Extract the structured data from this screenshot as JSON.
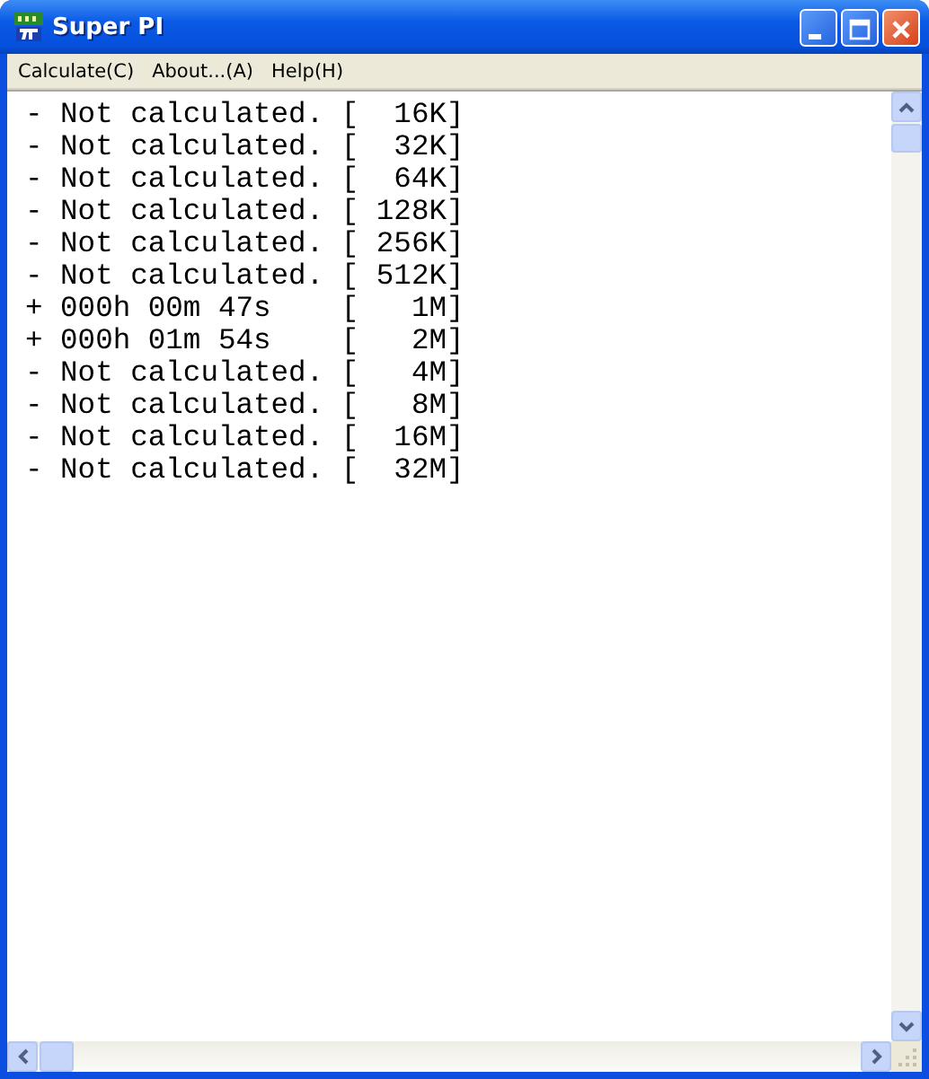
{
  "window": {
    "title": "Super PI"
  },
  "menu": [
    "Calculate(C)",
    "About...(A)",
    "Help(H)"
  ],
  "lines": [
    "- Not calculated. [  16K]",
    "- Not calculated. [  32K]",
    "- Not calculated. [  64K]",
    "- Not calculated. [ 128K]",
    "- Not calculated. [ 256K]",
    "- Not calculated. [ 512K]",
    "+ 000h 00m 47s    [   1M]",
    "+ 000h 01m 54s    [   2M]",
    "- Not calculated. [   4M]",
    "- Not calculated. [   8M]",
    "- Not calculated. [  16M]",
    "- Not calculated. [  32M]"
  ]
}
